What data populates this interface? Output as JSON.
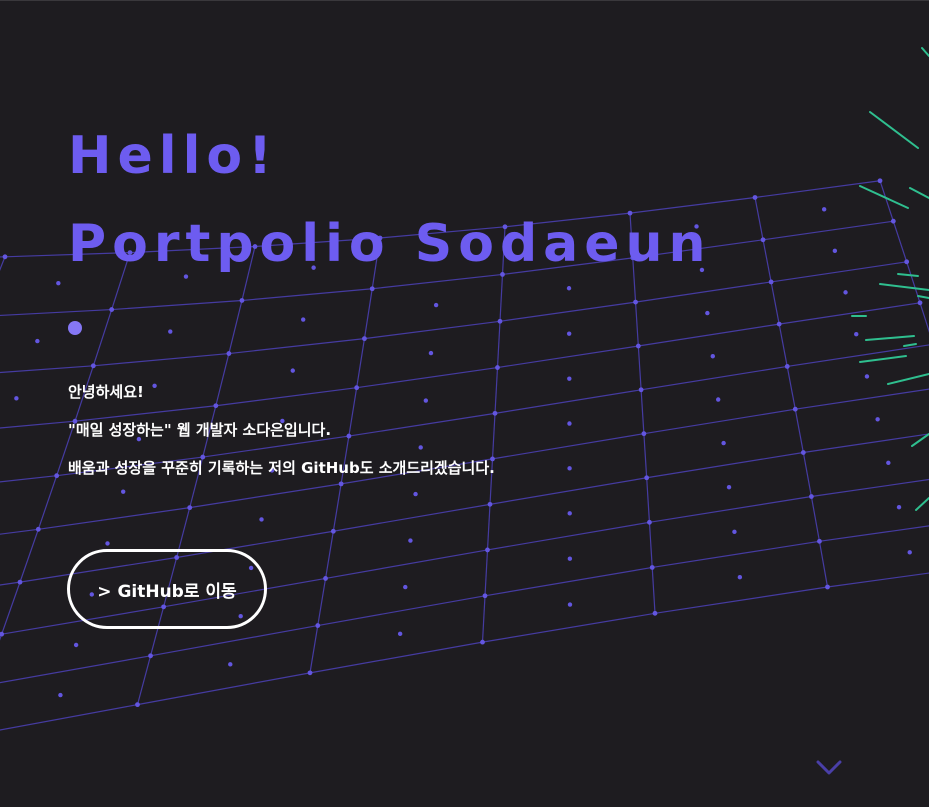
{
  "hero": {
    "title_line1": "Hello!",
    "title_line2": "Portpolio Sodaeun",
    "accent_color": "#6d5cf0"
  },
  "intro": {
    "line1": "안녕하세요!",
    "line2": "\"매일 성장하는\" 웹 개발자 소다은입니다.",
    "line3": "배움과 성장을 꾸준히 기록하는 저의 GitHub도 소개드리겠습니다."
  },
  "cta": {
    "label": "> GitHub로 이동"
  },
  "scroll_indicator": {
    "icon": "chevron-down-icon",
    "color": "#4a3fa8"
  },
  "background": {
    "color": "#1e1c20",
    "mesh_color": "#5247c4",
    "particle_color": "#2fbf8f"
  }
}
